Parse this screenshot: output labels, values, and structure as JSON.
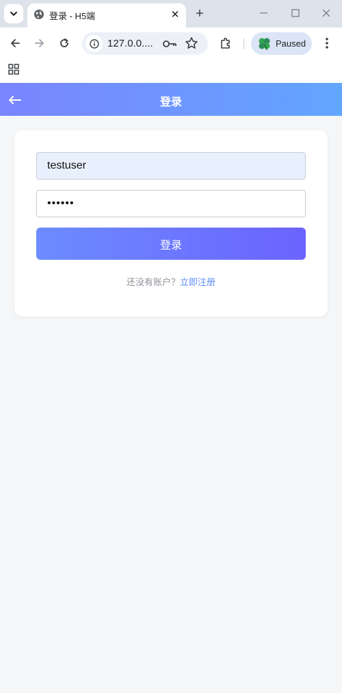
{
  "browser": {
    "tab_title": "登录 - H5端",
    "url": "127.0.0....",
    "profile_label": "Paused"
  },
  "page": {
    "nav_title": "登录",
    "username_value": "testuser",
    "password_value": "••••••",
    "login_button": "登录",
    "no_account_text": "还没有账户？",
    "register_link": "立即注册"
  },
  "colors": {
    "nav_gradient_start": "#7a85ff",
    "nav_gradient_end": "#62a6ff",
    "button_gradient_start": "#6c8cff",
    "button_gradient_end": "#6b63ff",
    "link": "#5b8ef7"
  }
}
